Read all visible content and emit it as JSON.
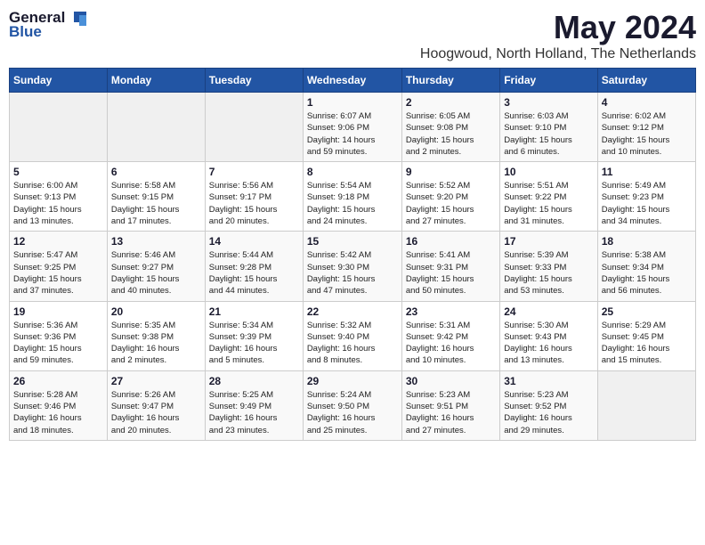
{
  "logo": {
    "general": "General",
    "blue": "Blue"
  },
  "title": "May 2024",
  "subtitle": "Hoogwoud, North Holland, The Netherlands",
  "weekdays": [
    "Sunday",
    "Monday",
    "Tuesday",
    "Wednesday",
    "Thursday",
    "Friday",
    "Saturday"
  ],
  "weeks": [
    [
      {
        "day": "",
        "info": ""
      },
      {
        "day": "",
        "info": ""
      },
      {
        "day": "",
        "info": ""
      },
      {
        "day": "1",
        "info": "Sunrise: 6:07 AM\nSunset: 9:06 PM\nDaylight: 14 hours\nand 59 minutes."
      },
      {
        "day": "2",
        "info": "Sunrise: 6:05 AM\nSunset: 9:08 PM\nDaylight: 15 hours\nand 2 minutes."
      },
      {
        "day": "3",
        "info": "Sunrise: 6:03 AM\nSunset: 9:10 PM\nDaylight: 15 hours\nand 6 minutes."
      },
      {
        "day": "4",
        "info": "Sunrise: 6:02 AM\nSunset: 9:12 PM\nDaylight: 15 hours\nand 10 minutes."
      }
    ],
    [
      {
        "day": "5",
        "info": "Sunrise: 6:00 AM\nSunset: 9:13 PM\nDaylight: 15 hours\nand 13 minutes."
      },
      {
        "day": "6",
        "info": "Sunrise: 5:58 AM\nSunset: 9:15 PM\nDaylight: 15 hours\nand 17 minutes."
      },
      {
        "day": "7",
        "info": "Sunrise: 5:56 AM\nSunset: 9:17 PM\nDaylight: 15 hours\nand 20 minutes."
      },
      {
        "day": "8",
        "info": "Sunrise: 5:54 AM\nSunset: 9:18 PM\nDaylight: 15 hours\nand 24 minutes."
      },
      {
        "day": "9",
        "info": "Sunrise: 5:52 AM\nSunset: 9:20 PM\nDaylight: 15 hours\nand 27 minutes."
      },
      {
        "day": "10",
        "info": "Sunrise: 5:51 AM\nSunset: 9:22 PM\nDaylight: 15 hours\nand 31 minutes."
      },
      {
        "day": "11",
        "info": "Sunrise: 5:49 AM\nSunset: 9:23 PM\nDaylight: 15 hours\nand 34 minutes."
      }
    ],
    [
      {
        "day": "12",
        "info": "Sunrise: 5:47 AM\nSunset: 9:25 PM\nDaylight: 15 hours\nand 37 minutes."
      },
      {
        "day": "13",
        "info": "Sunrise: 5:46 AM\nSunset: 9:27 PM\nDaylight: 15 hours\nand 40 minutes."
      },
      {
        "day": "14",
        "info": "Sunrise: 5:44 AM\nSunset: 9:28 PM\nDaylight: 15 hours\nand 44 minutes."
      },
      {
        "day": "15",
        "info": "Sunrise: 5:42 AM\nSunset: 9:30 PM\nDaylight: 15 hours\nand 47 minutes."
      },
      {
        "day": "16",
        "info": "Sunrise: 5:41 AM\nSunset: 9:31 PM\nDaylight: 15 hours\nand 50 minutes."
      },
      {
        "day": "17",
        "info": "Sunrise: 5:39 AM\nSunset: 9:33 PM\nDaylight: 15 hours\nand 53 minutes."
      },
      {
        "day": "18",
        "info": "Sunrise: 5:38 AM\nSunset: 9:34 PM\nDaylight: 15 hours\nand 56 minutes."
      }
    ],
    [
      {
        "day": "19",
        "info": "Sunrise: 5:36 AM\nSunset: 9:36 PM\nDaylight: 15 hours\nand 59 minutes."
      },
      {
        "day": "20",
        "info": "Sunrise: 5:35 AM\nSunset: 9:38 PM\nDaylight: 16 hours\nand 2 minutes."
      },
      {
        "day": "21",
        "info": "Sunrise: 5:34 AM\nSunset: 9:39 PM\nDaylight: 16 hours\nand 5 minutes."
      },
      {
        "day": "22",
        "info": "Sunrise: 5:32 AM\nSunset: 9:40 PM\nDaylight: 16 hours\nand 8 minutes."
      },
      {
        "day": "23",
        "info": "Sunrise: 5:31 AM\nSunset: 9:42 PM\nDaylight: 16 hours\nand 10 minutes."
      },
      {
        "day": "24",
        "info": "Sunrise: 5:30 AM\nSunset: 9:43 PM\nDaylight: 16 hours\nand 13 minutes."
      },
      {
        "day": "25",
        "info": "Sunrise: 5:29 AM\nSunset: 9:45 PM\nDaylight: 16 hours\nand 15 minutes."
      }
    ],
    [
      {
        "day": "26",
        "info": "Sunrise: 5:28 AM\nSunset: 9:46 PM\nDaylight: 16 hours\nand 18 minutes."
      },
      {
        "day": "27",
        "info": "Sunrise: 5:26 AM\nSunset: 9:47 PM\nDaylight: 16 hours\nand 20 minutes."
      },
      {
        "day": "28",
        "info": "Sunrise: 5:25 AM\nSunset: 9:49 PM\nDaylight: 16 hours\nand 23 minutes."
      },
      {
        "day": "29",
        "info": "Sunrise: 5:24 AM\nSunset: 9:50 PM\nDaylight: 16 hours\nand 25 minutes."
      },
      {
        "day": "30",
        "info": "Sunrise: 5:23 AM\nSunset: 9:51 PM\nDaylight: 16 hours\nand 27 minutes."
      },
      {
        "day": "31",
        "info": "Sunrise: 5:23 AM\nSunset: 9:52 PM\nDaylight: 16 hours\nand 29 minutes."
      },
      {
        "day": "",
        "info": ""
      }
    ]
  ]
}
